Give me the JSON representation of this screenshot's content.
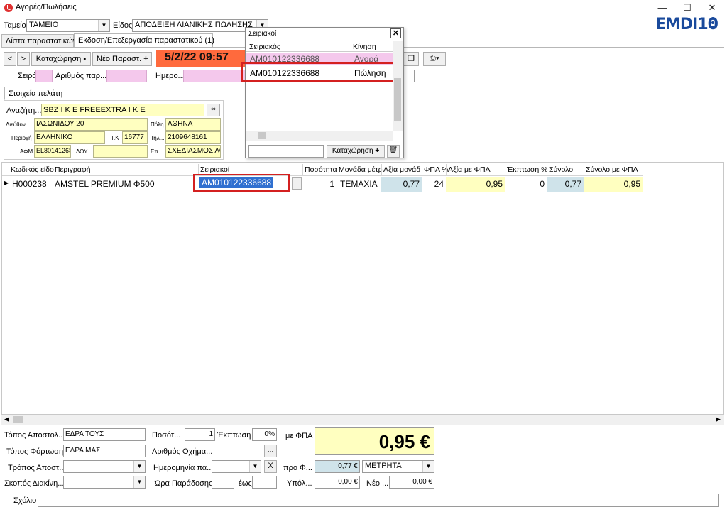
{
  "window": {
    "title": "Αγορές/Πωλήσεις",
    "minimize": "—",
    "maximize": "☐",
    "close": "✕"
  },
  "logo": {
    "text": "EMDI",
    "num": "10"
  },
  "header": {
    "tameio_label": "Ταμείο",
    "tameio_value": "ΤΑΜΕΙΟ",
    "eidos_label": "Είδος",
    "eidos_value": "ΑΠΟΔΕΙΞΗ ΛΙΑΝΙΚΗΣ ΠΩΛΗΣΗΣ"
  },
  "tabs": [
    "Λίστα παραστατικών",
    "Εκδοση/Επεξεργασία παραστατικού (1)"
  ],
  "toolbar": {
    "save_label": "Καταχώρηση",
    "new_label": "Νέο Παραστ.",
    "datetime": "5/2/22 09:57"
  },
  "doc": {
    "seira_label": "Σειρά",
    "arithmos_label": "Αριθμός παρ...",
    "date_label": "Ημερο..."
  },
  "customer": {
    "tab": "Στοιχεία πελάτη",
    "search_label": "Αναζήτη...",
    "search_value": "SBZ I K E  FREEEXTRA I K E",
    "address_label": "Διεύθυν...",
    "address": "ΙΑΣΩΝΙΔΟΥ 20",
    "city_label": "Πόλη",
    "city": "ΑΘΗΝΑ",
    "region_label": "Περιοχή",
    "region": "ΕΛΛΗΝΙΚΟ",
    "tk_label": "Τ.Κ",
    "tk": "16777",
    "phone_label": "Τηλ...",
    "phone": "2109648161",
    "afm_label": "ΑΦΜ",
    "afm": "EL80141268",
    "doy_label": "ΔΟΥ",
    "doy": "",
    "job_label": "Επ...",
    "job": "ΣΧΕΔΙΑΣΜΟΣ ΛΟΓ"
  },
  "popup": {
    "title": "Σειριακοί",
    "col_serial": "Σειριακός",
    "col_move": "Κίνηση",
    "rows": [
      {
        "serial": "AM010122336688",
        "move": "Αγορά"
      },
      {
        "serial": "AM010122336688",
        "move": "Πώληση"
      }
    ],
    "save_label": "Καταχώρηση"
  },
  "grid": {
    "headers": [
      "Κωδικός είδο",
      "Περιγραφή",
      "Σειριακοί",
      "Ποσότητα",
      "Μονάδα μέτρ",
      "Αξία μονάδ",
      "ΦΠΑ %",
      "Αξία με ΦΠΑ",
      "Έκπτωση %",
      "Σύνολο",
      "Σύνολο με ΦΠΑ"
    ],
    "row": {
      "code": "H000238",
      "desc": "AMSTEL PREMIUM Φ500",
      "serial": "AM010122336688",
      "qty": "1",
      "unit": "ΤΕΜΑΧΙΑ",
      "unit_value": "0,77",
      "vat": "24",
      "value_vat": "0,95",
      "discount": "0",
      "total": "0,77",
      "total_vat": "0,95"
    }
  },
  "footer": {
    "apostoli_label": "Τόπος Αποστολ...",
    "apostoli": "ΕΔΡΑ ΤΟΥΣ",
    "fortosi_label": "Τόπος Φόρτωσης",
    "fortosi": "ΕΔΡΑ ΜΑΣ",
    "tropos_label": "Τρόπος Αποστ...",
    "skopos_label": "Σκοπός Διακίνη...",
    "posotita_label": "Ποσότ...",
    "posotita": "1",
    "ekptosi_label": "Έκπτωση",
    "ekptosi": "0%",
    "oxima_label": "Αριθμός Οχήμα...",
    "hmerominia_label": "Ημερομηνία πα...",
    "x_label": "X",
    "ora_label": "Ώρα Παράδοσης",
    "eos_label": "έως",
    "me_fpa_label": "με ΦΠΑ",
    "total": "0,95 €",
    "pro_label": "προ Φ...",
    "pro": "0,77 €",
    "payment": "ΜΕΤΡΗΤΑ",
    "ypol_label": "Υπόλ...",
    "ypol": "0,00 €",
    "neo_label": "Νέο ...",
    "neo": "0,00 €",
    "sxolio_label": "Σχόλιο"
  }
}
